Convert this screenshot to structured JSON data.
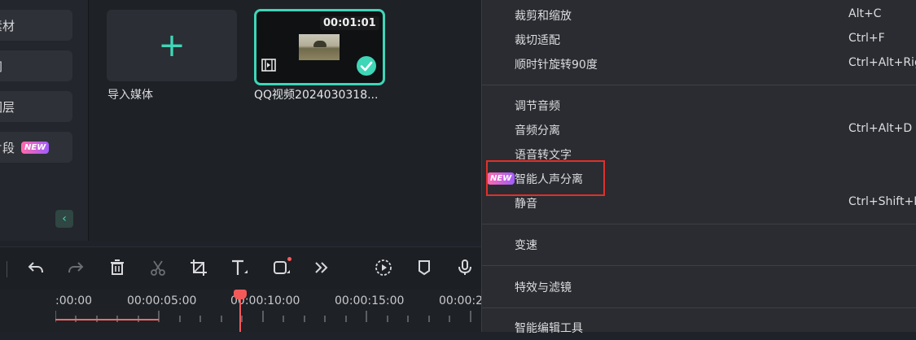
{
  "sidebar": {
    "items": [
      {
        "label": "素材"
      },
      {
        "label": "间"
      },
      {
        "label": "图层"
      },
      {
        "label": "片段",
        "badge": "NEW"
      }
    ],
    "collapse_icon": "chevron-left-icon"
  },
  "media": {
    "import_label": "导入媒体",
    "clip": {
      "duration": "00:01:01",
      "label": "QQ视频2024030318..."
    }
  },
  "toolbar": {
    "icons": [
      "undo-icon",
      "redo-icon",
      "delete-icon",
      "cut-icon",
      "crop-icon",
      "text-icon",
      "shape-icon",
      "more-icon",
      "playback-icon",
      "marker-icon",
      "microphone-icon"
    ]
  },
  "ruler": {
    "labels": [
      ":00:00",
      "00:00:05:00",
      "00:00:10:00",
      "00:00:15:00",
      "00:00:2"
    ]
  },
  "menu": {
    "items": [
      {
        "label": "裁剪和缩放",
        "shortcut": "Alt+C"
      },
      {
        "label": "裁切适配",
        "shortcut": "Ctrl+F"
      },
      {
        "label": "顺时针旋转90度",
        "shortcut": "Ctrl+Alt+Rig"
      },
      {
        "label": "调节音频",
        "shortcut": ""
      },
      {
        "label": "音频分离",
        "shortcut": "Ctrl+Alt+D"
      },
      {
        "label": "语音转文字",
        "shortcut": ""
      },
      {
        "label": "智能人声分离",
        "shortcut": "",
        "badge": "NEW"
      },
      {
        "label": "静音",
        "shortcut": "Ctrl+Shift+M"
      },
      {
        "label": "变速",
        "shortcut": ""
      },
      {
        "label": "特效与滤镜",
        "shortcut": ""
      },
      {
        "label": "智能编辑工具",
        "shortcut": ""
      }
    ]
  },
  "colors": {
    "accent": "#3ed6b7",
    "highlight": "#e0302a",
    "playhead": "#f25a5a"
  }
}
